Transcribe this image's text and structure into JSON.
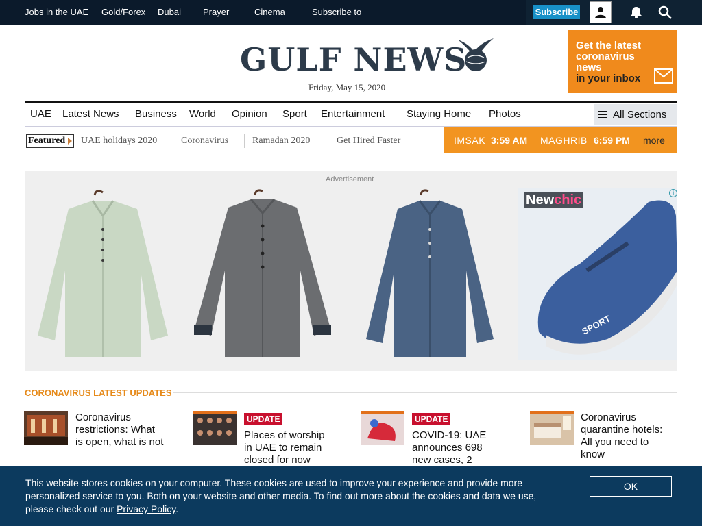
{
  "topbar": {
    "links": [
      "Jobs in the UAE",
      "Gold/Forex",
      "Dubai",
      "Prayer",
      "Cinema",
      "Subscribe to"
    ],
    "subscribe_label": "Subscribe"
  },
  "header": {
    "logo_text": "GULF NEWS",
    "date": "Friday, May 15, 2020",
    "promo": {
      "line1": "Get the latest",
      "line2": "coronavirus",
      "line3": "news",
      "line4": "in your inbox",
      "color": "#f08a1c"
    }
  },
  "nav": {
    "items": [
      "UAE",
      "Latest News",
      "Business",
      "World",
      "Opinion",
      "Sport",
      "Entertainment",
      "Staying Home",
      "Photos"
    ],
    "all_sections": "All Sections"
  },
  "featured": {
    "label": "Featured",
    "tags": [
      "UAE holidays 2020",
      "Coronavirus",
      "Ramadan 2020",
      "Get Hired Faster"
    ]
  },
  "prayer": {
    "imsak_label": "IMSAK",
    "imsak_time": "3:59 AM",
    "maghrib_label": "MAGHRIB",
    "maghrib_time": "6:59 PM",
    "more": "more",
    "color": "#f29420"
  },
  "ad": {
    "label": "Advertisement",
    "brand_new": "New",
    "brand_chic": "chic",
    "shoe_text": "SPORT"
  },
  "covid": {
    "section_title": "CORONAVIRUS LATEST UPDATES",
    "stories": [
      {
        "badge": "",
        "title_lines": [
          "Coronavirus",
          "restrictions: What",
          "is open, what is not"
        ]
      },
      {
        "badge": "UPDATE",
        "title_lines": [
          "Places of worship",
          "in UAE to remain",
          "closed for now"
        ]
      },
      {
        "badge": "UPDATE",
        "title_lines": [
          "COVID-19: UAE",
          "announces 698",
          "new cases, 2"
        ]
      },
      {
        "badge": "",
        "title_lines": [
          "Coronavirus",
          "quarantine hotels:",
          "All you need to",
          "know"
        ]
      }
    ]
  },
  "cookie": {
    "text_line1": "This website stores cookies on your computer. These cookies are used to improve your experience and provide more",
    "text_line2": "personalized service to you. Both on your website and other media. To find out more about the cookies and data we use,",
    "text_line3_prefix": "please check out our ",
    "privacy_link": "Privacy Policy",
    "text_line3_suffix": ".",
    "ok_label": "OK"
  }
}
